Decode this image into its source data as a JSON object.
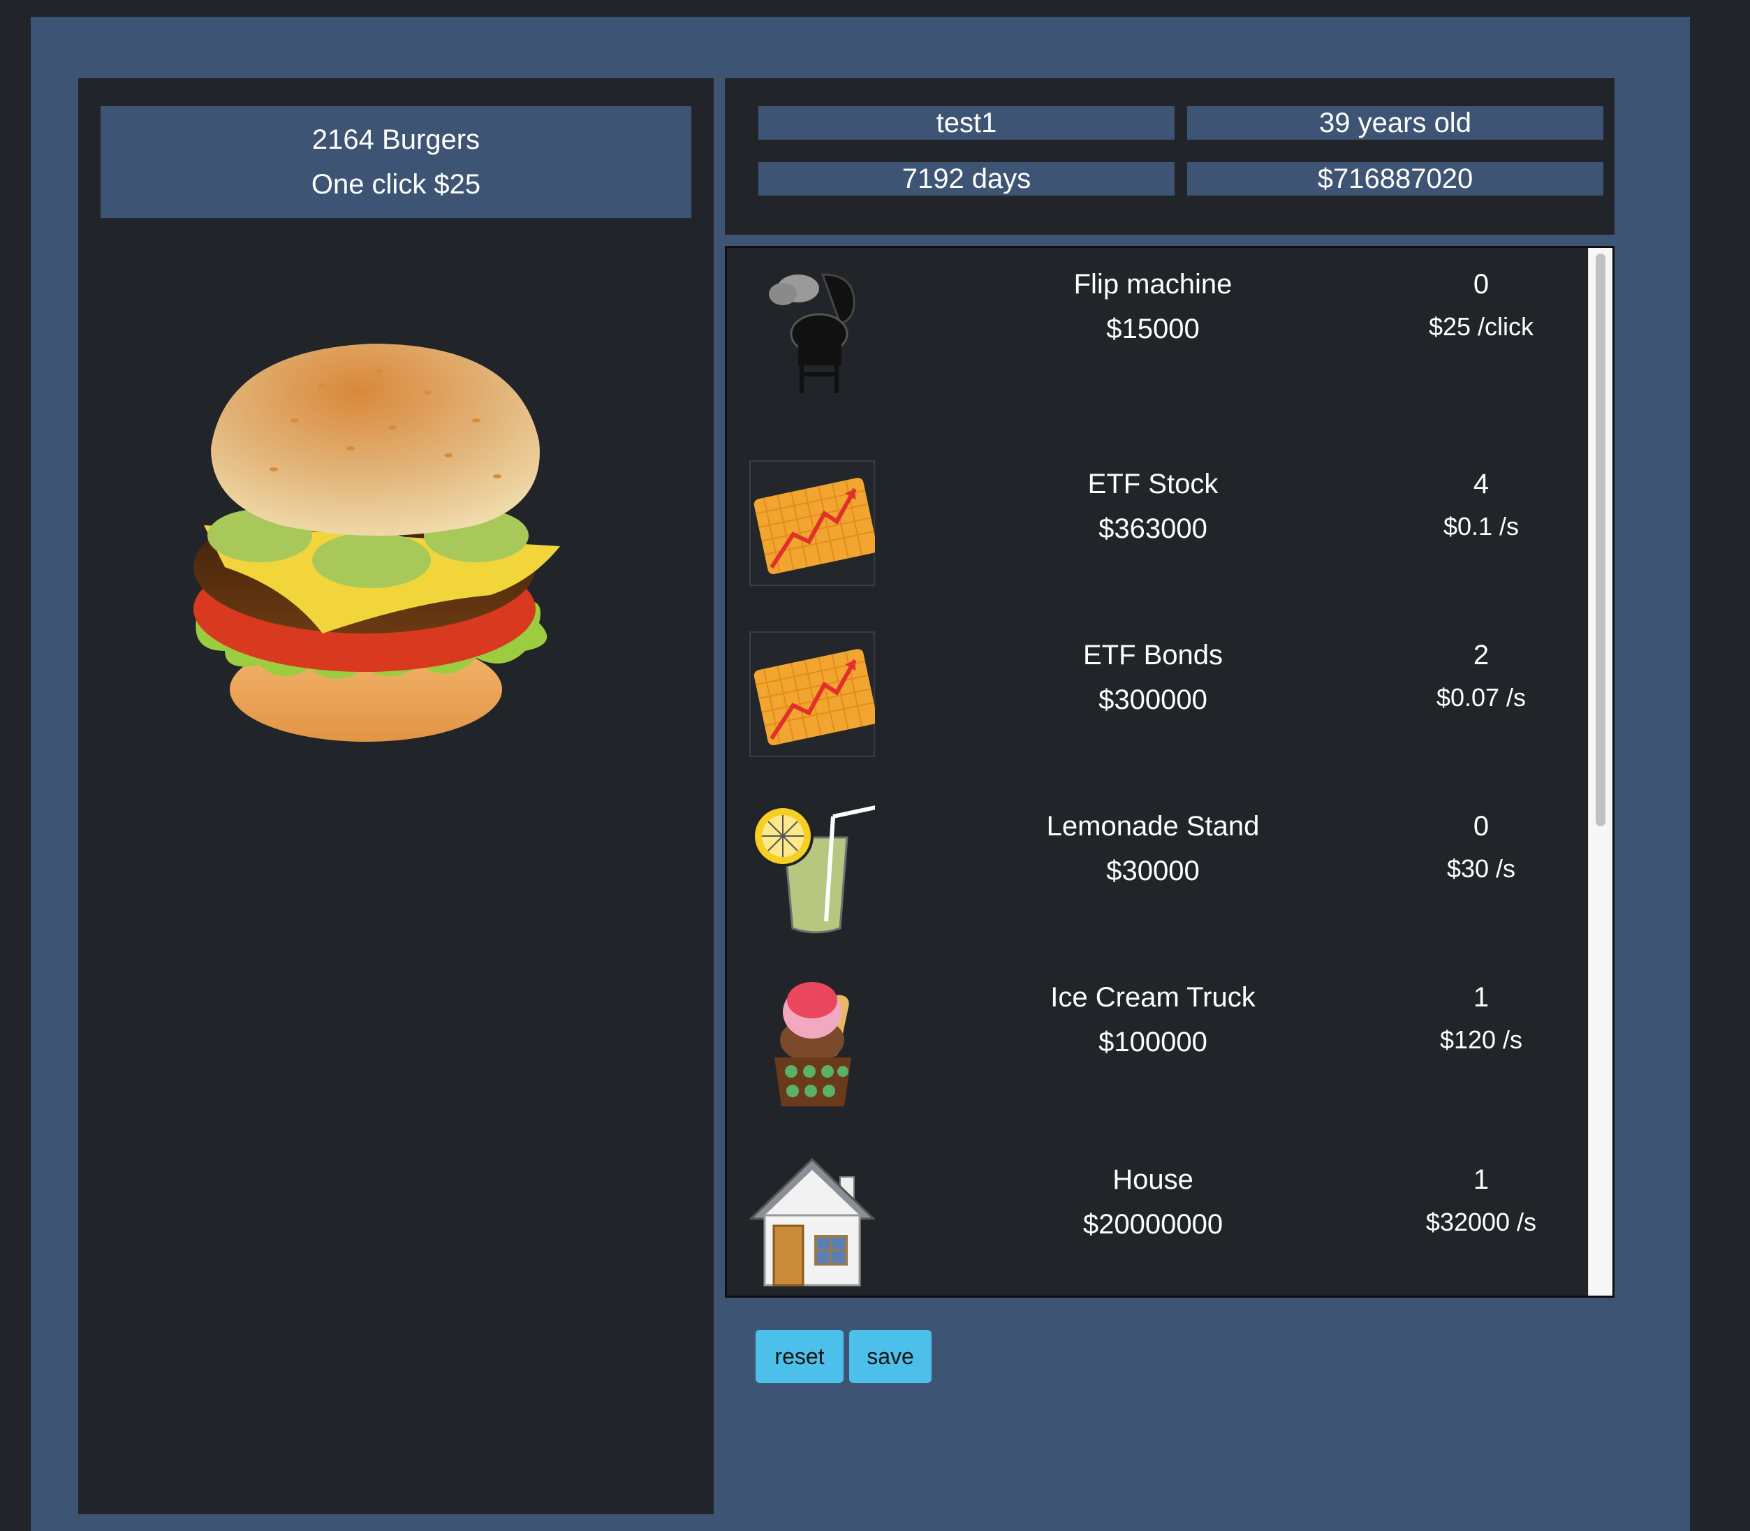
{
  "counter": {
    "burgers": "2164 Burgers",
    "per_click": "One click $25"
  },
  "stats": {
    "username": "test1",
    "age": "39 years old",
    "days": "7192 days",
    "money": "$716887020"
  },
  "shop": {
    "items": [
      {
        "name": "Flip machine",
        "price": "$15000",
        "owned": "0",
        "rate": "$25 /click",
        "icon": "grill-icon"
      },
      {
        "name": "ETF Stock",
        "price": "$363000",
        "owned": "4",
        "rate": "$0.1 /s",
        "icon": "stock-chart-icon"
      },
      {
        "name": "ETF Bonds",
        "price": "$300000",
        "owned": "2",
        "rate": "$0.07 /s",
        "icon": "stock-chart-icon"
      },
      {
        "name": "Lemonade Stand",
        "price": "$30000",
        "owned": "0",
        "rate": "$30 /s",
        "icon": "lemonade-icon"
      },
      {
        "name": "Ice Cream Truck",
        "price": "$100000",
        "owned": "1",
        "rate": "$120 /s",
        "icon": "ice-cream-icon"
      },
      {
        "name": "House",
        "price": "$20000000",
        "owned": "1",
        "rate": "$32000 /s",
        "icon": "house-icon"
      }
    ]
  },
  "buttons": {
    "reset": "reset",
    "save": "save"
  },
  "colors": {
    "background": "#212429",
    "panel": "#3e5475",
    "button": "#4cc0ea"
  }
}
